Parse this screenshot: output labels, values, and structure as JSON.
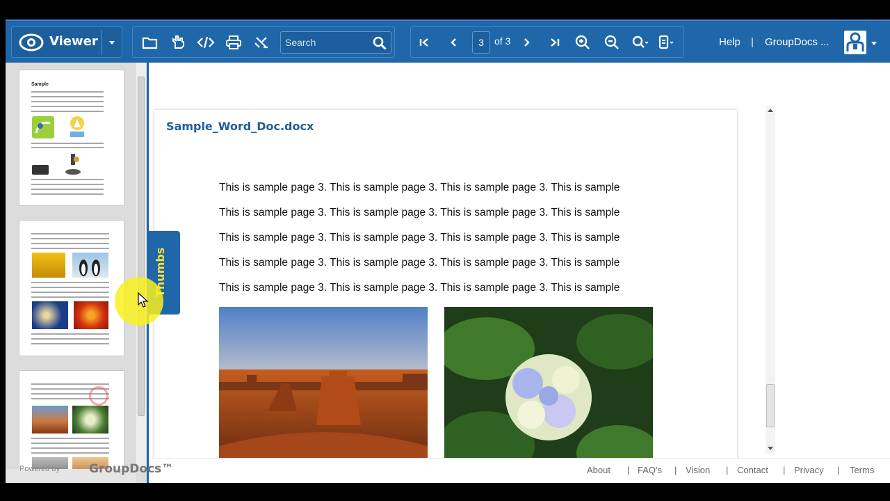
{
  "toolbar": {
    "viewer_label": "Viewer",
    "search_placeholder": "Search",
    "page_current": "3",
    "page_of": "of 3",
    "help_label": "Help",
    "separator": "|",
    "groupdocs_label": "GroupDocs ..."
  },
  "sidebar": {
    "tab_label": "Thumbs",
    "thumb1_heading": "Sample",
    "powered_by": "Powered by",
    "powered_brand": "GroupDocs™"
  },
  "document": {
    "file_name": "Sample_Word_Doc.docx",
    "lines": [
      "This is sample page 3. This is sample page 3. This is sample page 3. This is sample",
      "This is sample page 3. This is sample page 3. This is sample page 3. This is sample",
      "This is sample page 3. This is sample page 3. This is sample page 3. This is sample",
      "This is sample page 3. This is sample page 3. This is sample page 3. This is sample",
      "This is sample page 3. This is sample page 3. This is sample page 3. This is sample"
    ]
  },
  "footer": {
    "about": "About",
    "faqs": "FAQ's",
    "vision": "Vision",
    "contact": "Contact",
    "privacy": "Privacy",
    "terms": "Terms",
    "separator": "|"
  },
  "colors": {
    "toolbar_bg": "#1f67a8",
    "title_blue": "#1f5e96",
    "thumbs_tab_text": "#ffe23a"
  }
}
